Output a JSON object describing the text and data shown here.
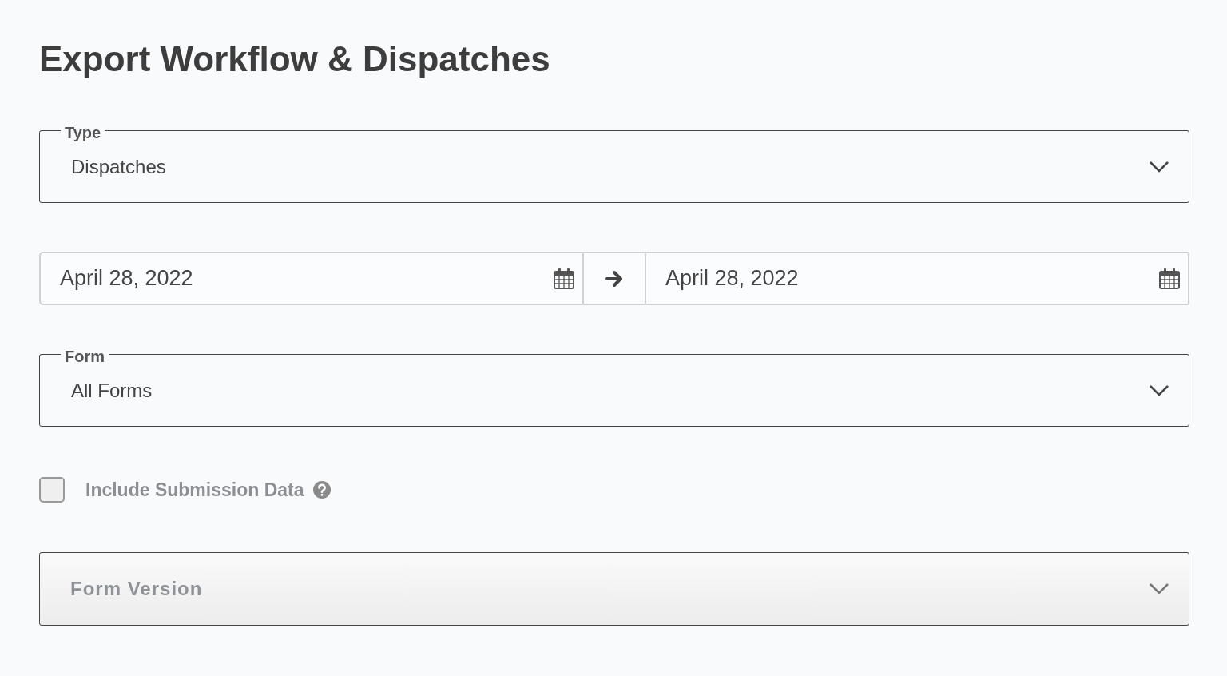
{
  "title": "Export Workflow & Dispatches",
  "type_select": {
    "label": "Type",
    "value": "Dispatches"
  },
  "date_range": {
    "start": "April 28, 2022",
    "end": "April 28, 2022"
  },
  "form_select": {
    "label": "Form",
    "value": "All Forms"
  },
  "include_submission": {
    "label": "Include Submission Data",
    "checked": false,
    "disabled": true
  },
  "form_version": {
    "placeholder": "Form Version",
    "disabled": true
  }
}
